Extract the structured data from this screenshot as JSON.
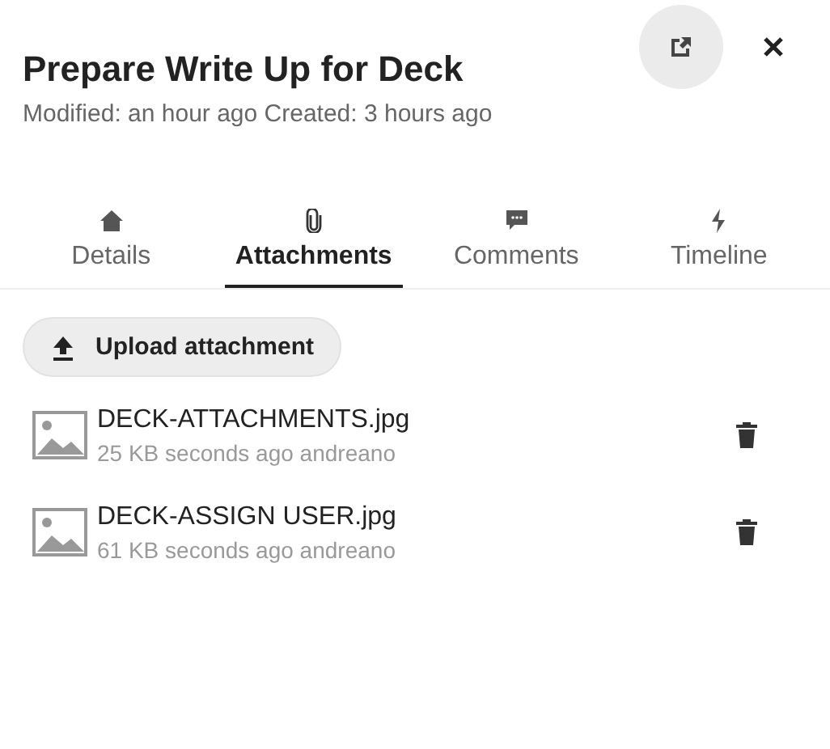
{
  "card": {
    "title": "Prepare Write Up for Deck",
    "meta": "Modified: an hour ago Created: 3 hours ago"
  },
  "tabs": [
    {
      "label": "Details",
      "selected": false
    },
    {
      "label": "Attachments",
      "selected": true
    },
    {
      "label": "Comments",
      "selected": false
    },
    {
      "label": "Timeline",
      "selected": false
    }
  ],
  "upload_button": "Upload attachment",
  "attachments": [
    {
      "name": "DECK-ATTACHMENTS.jpg",
      "info": "25 KB seconds ago andreano"
    },
    {
      "name": "DECK-ASSIGN USER.jpg",
      "info": "61 KB seconds ago andreano"
    }
  ]
}
